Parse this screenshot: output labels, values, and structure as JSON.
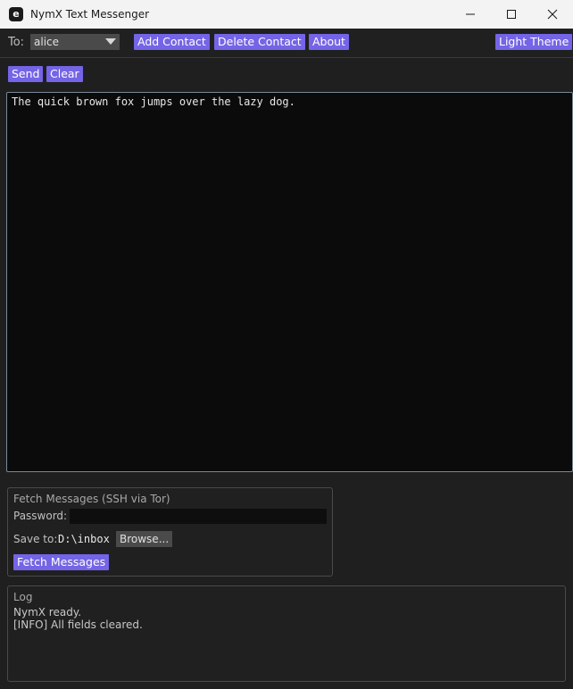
{
  "window": {
    "app_icon": "e",
    "title": "NymX Text Messenger",
    "controls": [
      "minimize-icon",
      "maximize-icon",
      "close-icon"
    ]
  },
  "toolbar": {
    "to_label": "To:",
    "recipient_selected": "alice",
    "add_contact_label": "Add Contact",
    "delete_contact_label": "Delete Contact",
    "about_label": "About",
    "theme_label": "Light Theme"
  },
  "actions": {
    "send_label": "Send",
    "clear_label": "Clear"
  },
  "message": {
    "text": "The quick brown fox jumps over the lazy dog."
  },
  "fetch": {
    "title": "Fetch Messages (SSH via Tor)",
    "password_label": "Password:",
    "password_value": "",
    "save_label": "Save to:",
    "save_path": "D:\\inbox",
    "browse_label": "Browse...",
    "fetch_label": "Fetch Messages"
  },
  "log": {
    "title": "Log",
    "lines": [
      "NymX ready.",
      "[INFO] All fields cleared."
    ]
  },
  "colors": {
    "accent": "#7464e6",
    "background": "#1f1f1f",
    "text_area_bg": "#0b0b0b"
  }
}
